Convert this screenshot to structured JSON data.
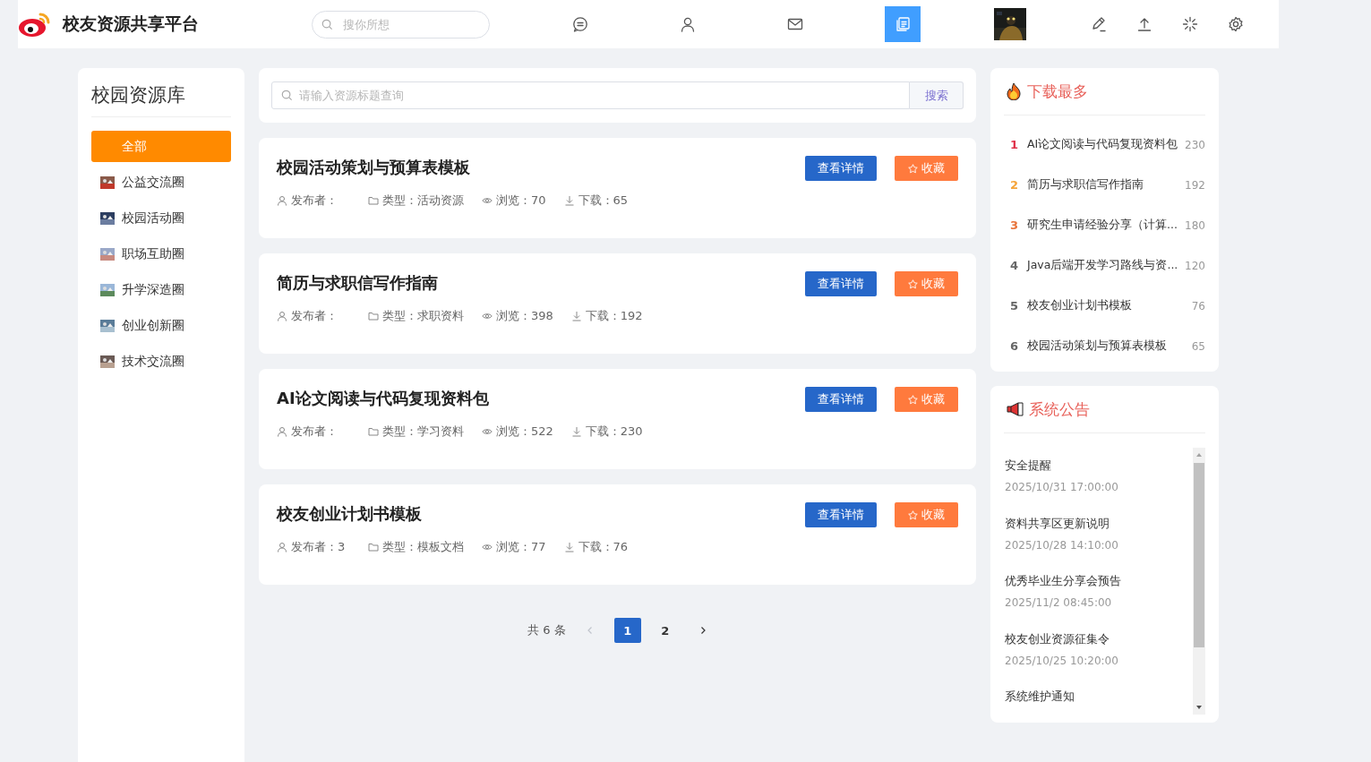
{
  "header": {
    "title": "校友资源共享平台",
    "search": {
      "placeholder": "搜你所想"
    },
    "nav": [
      {
        "kind": "icon",
        "selected": false
      },
      {
        "kind": "icon",
        "selected": false
      },
      {
        "kind": "icon",
        "selected": false
      },
      {
        "kind": "icon",
        "selected": true
      },
      {
        "kind": "picture",
        "selected": false
      },
      {
        "kind": "icon",
        "selected": false
      },
      {
        "kind": "icon",
        "selected": false
      },
      {
        "kind": "icon",
        "selected": false
      },
      {
        "kind": "icon",
        "selected": false
      }
    ]
  },
  "sidebar": {
    "title": "校园资源库",
    "items": [
      {
        "label": "全部",
        "selected": true,
        "thumbnail": false
      },
      {
        "label": "公益交流圈",
        "selected": false,
        "thumbnail": true
      },
      {
        "label": "校园活动圈",
        "selected": false,
        "thumbnail": true
      },
      {
        "label": "职场互助圈",
        "selected": false,
        "thumbnail": true
      },
      {
        "label": "升学深造圈",
        "selected": false,
        "thumbnail": true
      },
      {
        "label": "创业创新圈",
        "selected": false,
        "thumbnail": true
      },
      {
        "label": "技术交流圈",
        "selected": false,
        "thumbnail": true
      }
    ]
  },
  "resource_search": {
    "placeholder": "请输入资源标题查询",
    "button": "搜索"
  },
  "resources": [
    {
      "title": "校园活动策划与预算表模板",
      "publisher": "发布者：",
      "type": "类型：活动资源",
      "views": "浏览：70",
      "downloads": "下载：65",
      "detail_button": "查看详情",
      "favorite_button": "收藏"
    },
    {
      "title": "简历与求职信写作指南",
      "publisher": "发布者：",
      "type": "类型：求职资料",
      "views": "浏览：398",
      "downloads": "下载：192",
      "detail_button": "查看详情",
      "favorite_button": "收藏"
    },
    {
      "title": "AI论文阅读与代码复现资料包",
      "publisher": "发布者：",
      "type": "类型：学习资料",
      "views": "浏览：522",
      "downloads": "下载：230",
      "detail_button": "查看详情",
      "favorite_button": "收藏"
    },
    {
      "title": "校友创业计划书模板",
      "publisher": "发布者：3",
      "type": "类型：模板文档",
      "views": "浏览：77",
      "downloads": "下载：76",
      "detail_button": "查看详情",
      "favorite_button": "收藏"
    }
  ],
  "pagination": {
    "total": "共 6 条",
    "prev_disabled": true,
    "pages": [
      {
        "label": "1",
        "selected": true
      },
      {
        "label": "2",
        "selected": false
      }
    ]
  },
  "top_downloads": {
    "title": "下载最多",
    "items": [
      {
        "rank": "1",
        "color": "#e0334a",
        "title": "AI论文阅读与代码复现资料包",
        "count": "230"
      },
      {
        "rank": "2",
        "color": "#f5a43a",
        "title": "简历与求职信写作指南",
        "count": "192"
      },
      {
        "rank": "3",
        "color": "#e8733a",
        "title": "研究生申请经验分享（计算...",
        "count": "180"
      },
      {
        "rank": "4",
        "color": "#666666",
        "title": "Java后端开发学习路线与资...",
        "count": "120"
      },
      {
        "rank": "5",
        "color": "#666666",
        "title": "校友创业计划书模板",
        "count": "76"
      },
      {
        "rank": "6",
        "color": "#666666",
        "title": "校园活动策划与预算表模板",
        "count": "65"
      }
    ]
  },
  "announcements": {
    "title": "系统公告",
    "items": [
      {
        "title": "安全提醒",
        "time": "2025/10/31 17:00:00"
      },
      {
        "title": "资料共享区更新说明",
        "time": "2025/10/28 14:10:00"
      },
      {
        "title": "优秀毕业生分享会预告",
        "time": "2025/11/2 08:45:00"
      },
      {
        "title": "校友创业资源征集令",
        "time": "2025/10/25 10:20:00"
      },
      {
        "title": "系统维护通知"
      }
    ]
  }
}
